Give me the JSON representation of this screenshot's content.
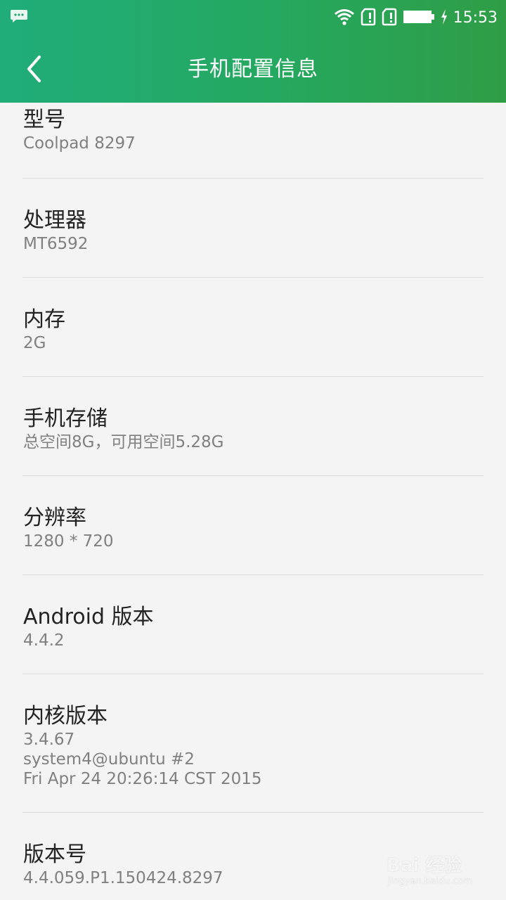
{
  "status_bar": {
    "time": "15:53",
    "icons": [
      "notification-bubble-icon",
      "wifi-icon",
      "sim-card-1-icon",
      "sim-card-2-icon",
      "battery-icon",
      "charging-icon"
    ]
  },
  "header": {
    "title": "手机配置信息",
    "back_icon": "chevron-left-icon",
    "color_start": "#20ad7a",
    "color_end": "#2f9d46"
  },
  "items": [
    {
      "label": "型号",
      "values": [
        "Coolpad 8297"
      ]
    },
    {
      "label": "处理器",
      "values": [
        "MT6592"
      ]
    },
    {
      "label": "内存",
      "values": [
        "2G"
      ]
    },
    {
      "label": "手机存储",
      "values": [
        "总空间8G，可用空间5.28G"
      ]
    },
    {
      "label": "分辨率",
      "values": [
        "1280 * 720"
      ]
    },
    {
      "label": "Android 版本",
      "values": [
        "4.4.2"
      ]
    },
    {
      "label": "内核版本",
      "values": [
        "3.4.67",
        "system4@ubuntu #2",
        "Fri Apr 24 20:26:14 CST 2015"
      ]
    },
    {
      "label": "版本号",
      "values": [
        "4.4.059.P1.150424.8297"
      ]
    }
  ],
  "watermark": {
    "main": "Bai 经验",
    "sub": "jingyan.baidu.com"
  }
}
